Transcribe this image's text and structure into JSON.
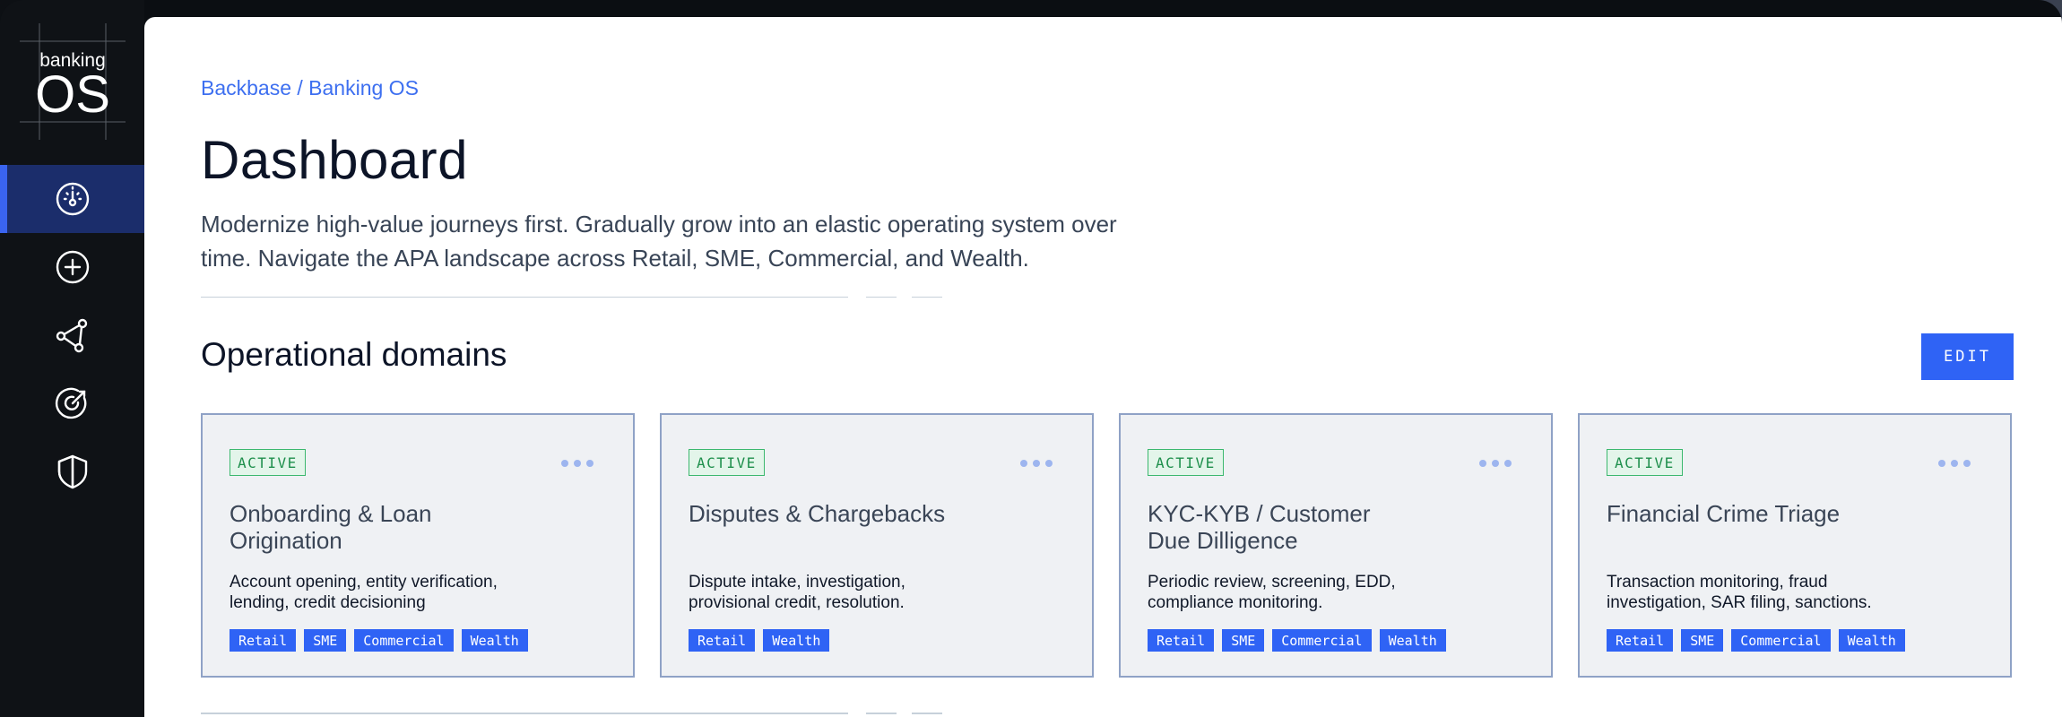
{
  "app": {
    "logo_small": "banking",
    "logo_big": "OS"
  },
  "sidebar": {
    "items": [
      {
        "icon": "dashboard-gauge-icon",
        "active": true
      },
      {
        "icon": "add-circle-icon",
        "active": false
      },
      {
        "icon": "network-share-icon",
        "active": false
      },
      {
        "icon": "target-icon",
        "active": false
      },
      {
        "icon": "shield-icon",
        "active": false
      }
    ]
  },
  "header": {
    "breadcrumb": "Backbase / Banking OS",
    "title": "Dashboard",
    "description": "Modernize high-value journeys first. Gradually grow into an elastic operating system over time. Navigate the APA landscape across Retail, SME, Commercial, and Wealth."
  },
  "section": {
    "title": "Operational domains",
    "edit_label": "EDIT"
  },
  "cards": [
    {
      "status": "ACTIVE",
      "title": "Onboarding & Loan Origination",
      "description": "Account opening, entity verification, lending, credit decisioning",
      "tags": [
        "Retail",
        "SME",
        "Commercial",
        "Wealth"
      ]
    },
    {
      "status": "ACTIVE",
      "title": "Disputes & Chargebacks",
      "description": "Dispute intake, investigation, provisional credit, resolution.",
      "tags": [
        "Retail",
        "Wealth"
      ]
    },
    {
      "status": "ACTIVE",
      "title": "KYC-KYB / Customer Due Dilligence",
      "description": "Periodic review, screening, EDD, compliance monitoring.",
      "tags": [
        "Retail",
        "SME",
        "Commercial",
        "Wealth"
      ]
    },
    {
      "status": "ACTIVE",
      "title": "Financial Crime Triage",
      "description": "Transaction monitoring, fraud investigation, SAR filing, sanctions.",
      "tags": [
        "Retail",
        "SME",
        "Commercial",
        "Wealth"
      ]
    }
  ],
  "colors": {
    "accent": "#2f63f5",
    "sidebar_bg": "#0f1216",
    "active_nav_bg": "#1b2d6b",
    "badge_green": "#1e8f4c"
  }
}
